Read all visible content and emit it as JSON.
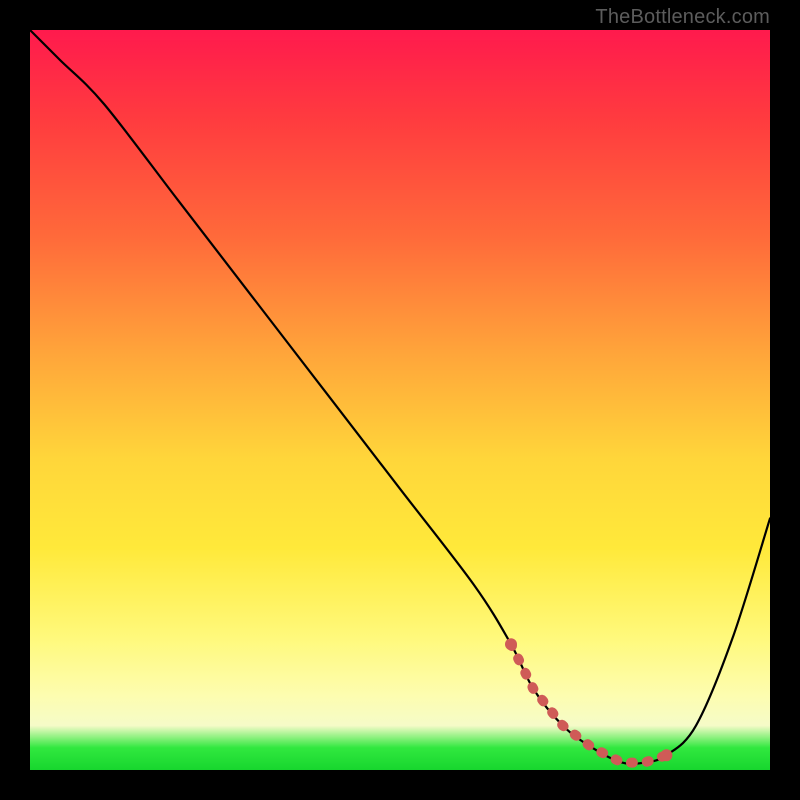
{
  "attribution": "TheBottleneck.com",
  "colors": {
    "valley_stroke": "#cf5b57",
    "curve_stroke": "#000000",
    "gradient_top": "#ff1a4d",
    "gradient_bottom": "#17d62e"
  },
  "chart_data": {
    "type": "line",
    "title": "",
    "xlabel": "",
    "ylabel": "",
    "xlim": [
      0,
      100
    ],
    "ylim": [
      0,
      100
    ],
    "grid": false,
    "series": [
      {
        "name": "bottleneck-curve",
        "x": [
          0,
          4,
          10,
          20,
          30,
          40,
          50,
          60,
          65,
          68,
          72,
          76,
          80,
          83,
          86,
          90,
          95,
          100
        ],
        "y": [
          100,
          96,
          90,
          77,
          64,
          51,
          38,
          25,
          17,
          11,
          6,
          3,
          1,
          1,
          2,
          6,
          18,
          34
        ]
      }
    ],
    "annotations": [
      {
        "name": "optimal-range",
        "x_start": 65,
        "x_end": 86,
        "y": 1
      }
    ]
  }
}
